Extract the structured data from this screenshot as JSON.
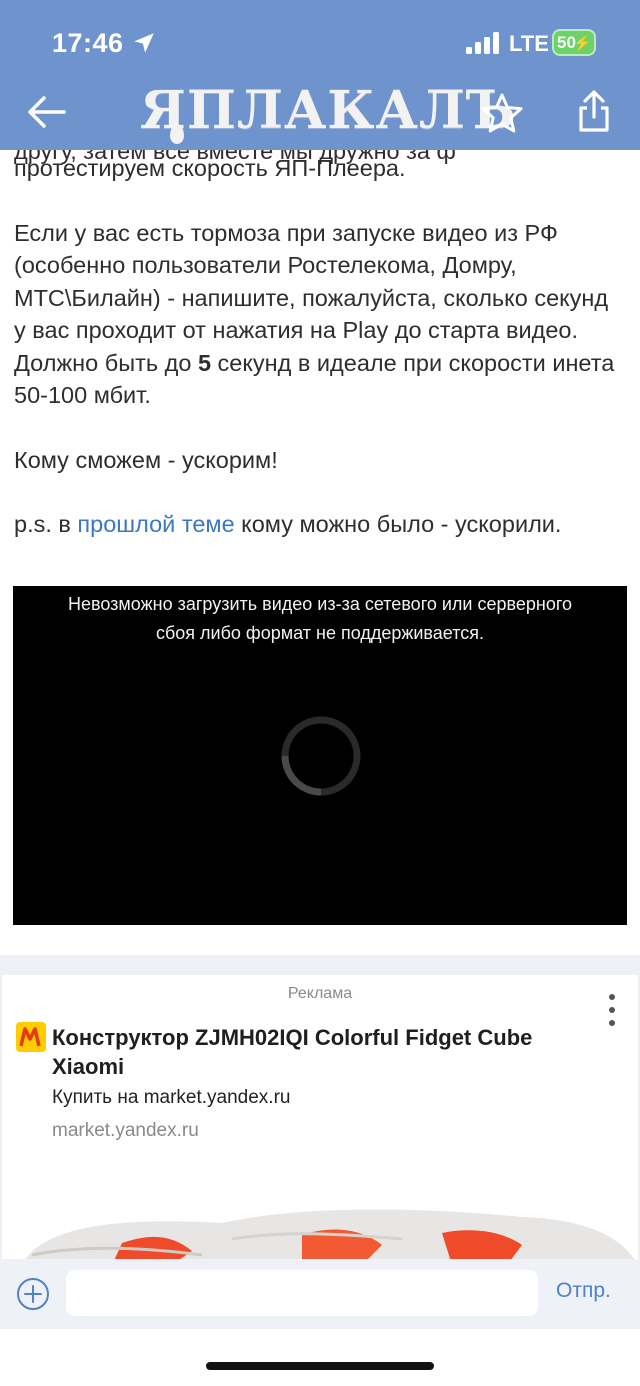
{
  "status_bar": {
    "time": "17:46",
    "network": "LTE",
    "battery": "50",
    "icons": [
      "location-arrow-icon",
      "signal-bars-icon",
      "battery-charging-icon"
    ]
  },
  "nav": {
    "logo_text": "ЯПЛАКАЛЪ",
    "icons": [
      "back-arrow-icon",
      "star-icon",
      "share-icon"
    ]
  },
  "article": {
    "cut_line": "другу, затем все вместе мы дружно за ф",
    "line_1": "протестируем скорость ЯП-Плеера.",
    "para_2_a": "Если у вас есть тормоза при запуске видео из РФ (особенно пользователи Ростелекома, Домру, МТС\\Билайн) - напишите, пожалуйста, сколько секунд у вас проходит от нажатия на Play до старта видео. Должно быть до ",
    "para_2_bold": "5",
    "para_2_b": " секунд в идеале при скорости инета 50-100 мбит.",
    "para_3": "Кому сможем - ускорим!",
    "ps_prefix": "p.s. в ",
    "ps_link": "прошлой теме",
    "ps_suffix": " кому можно было - ускорили."
  },
  "video": {
    "error_line_1": "Невозможно загрузить видео из-за сетевого или серверного",
    "error_line_2": "сбоя либо формат не поддерживается."
  },
  "ad": {
    "label": "Реклама",
    "title": "Конструктор ZJMH02IQI Colorful Fidget Cube Xiaomi",
    "subtitle": "Купить на market.yandex.ru",
    "domain": "market.yandex.ru"
  },
  "composer": {
    "input_value": "",
    "input_placeholder": "",
    "send_label": "Отпр."
  },
  "colors": {
    "header_bg": "#6f93cc",
    "link": "#3c78c0",
    "send": "#4f82c8"
  }
}
